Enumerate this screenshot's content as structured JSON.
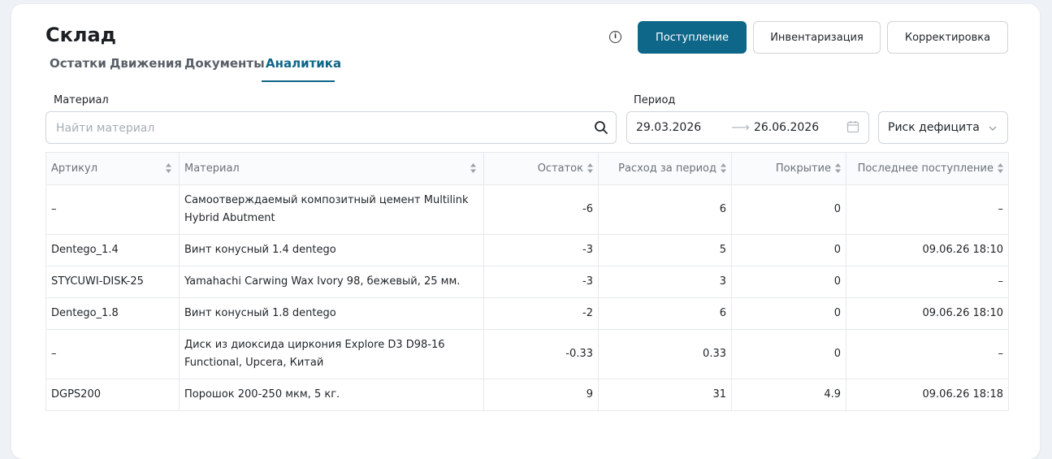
{
  "page": {
    "title": "Склад"
  },
  "tabs": [
    {
      "label": "Остатки",
      "active": false
    },
    {
      "label": "Движения",
      "active": false
    },
    {
      "label": "Документы",
      "active": false
    },
    {
      "label": "Аналитика",
      "active": true
    }
  ],
  "header_actions": {
    "info_icon": "info-icon",
    "primary_button": "Поступление",
    "inventory_button": "Инвентаризация",
    "correction_button": "Корректировка"
  },
  "filters": {
    "material_label": "Материал",
    "search_placeholder": "Найти материал",
    "search_value": "",
    "period_label": "Период",
    "date_from": "29.03.2026",
    "date_to": "26.06.2026",
    "risk_select_value": "Риск дефицита"
  },
  "table": {
    "columns": [
      "Артикул",
      "Материал",
      "Остаток",
      "Расход за период",
      "Покрытие",
      "Последнее поступление"
    ],
    "rows": [
      [
        "–",
        "Самоотверждаемый композитный цемент Multilink Hybrid Abutment",
        "-6",
        "6",
        "0",
        "–"
      ],
      [
        "Dentego_1.4",
        "Винт конусный 1.4 dentego",
        "-3",
        "5",
        "0",
        "09.06.26 18:10"
      ],
      [
        "STYCUWI-DISK-25",
        "Yamahachi Carwing Wax Ivory 98, бежевый, 25 мм.",
        "-3",
        "3",
        "0",
        "–"
      ],
      [
        "Dentego_1.8",
        "Винт конусный 1.8 dentego",
        "-2",
        "6",
        "0",
        "09.06.26 18:10"
      ],
      [
        "–",
        "Диск из диоксида циркония Explore D3 D98-16 Functional, Upcera, Китай",
        "-0.33",
        "0.33",
        "0",
        "–"
      ],
      [
        "DGPS200",
        "Порошок 200-250 мкм, 5 кг.",
        "9",
        "31",
        "4.9",
        "09.06.26 18:18"
      ]
    ]
  },
  "colors": {
    "accent": "#0e6688",
    "border": "#cfd4da",
    "muted_text": "#6b7178"
  }
}
